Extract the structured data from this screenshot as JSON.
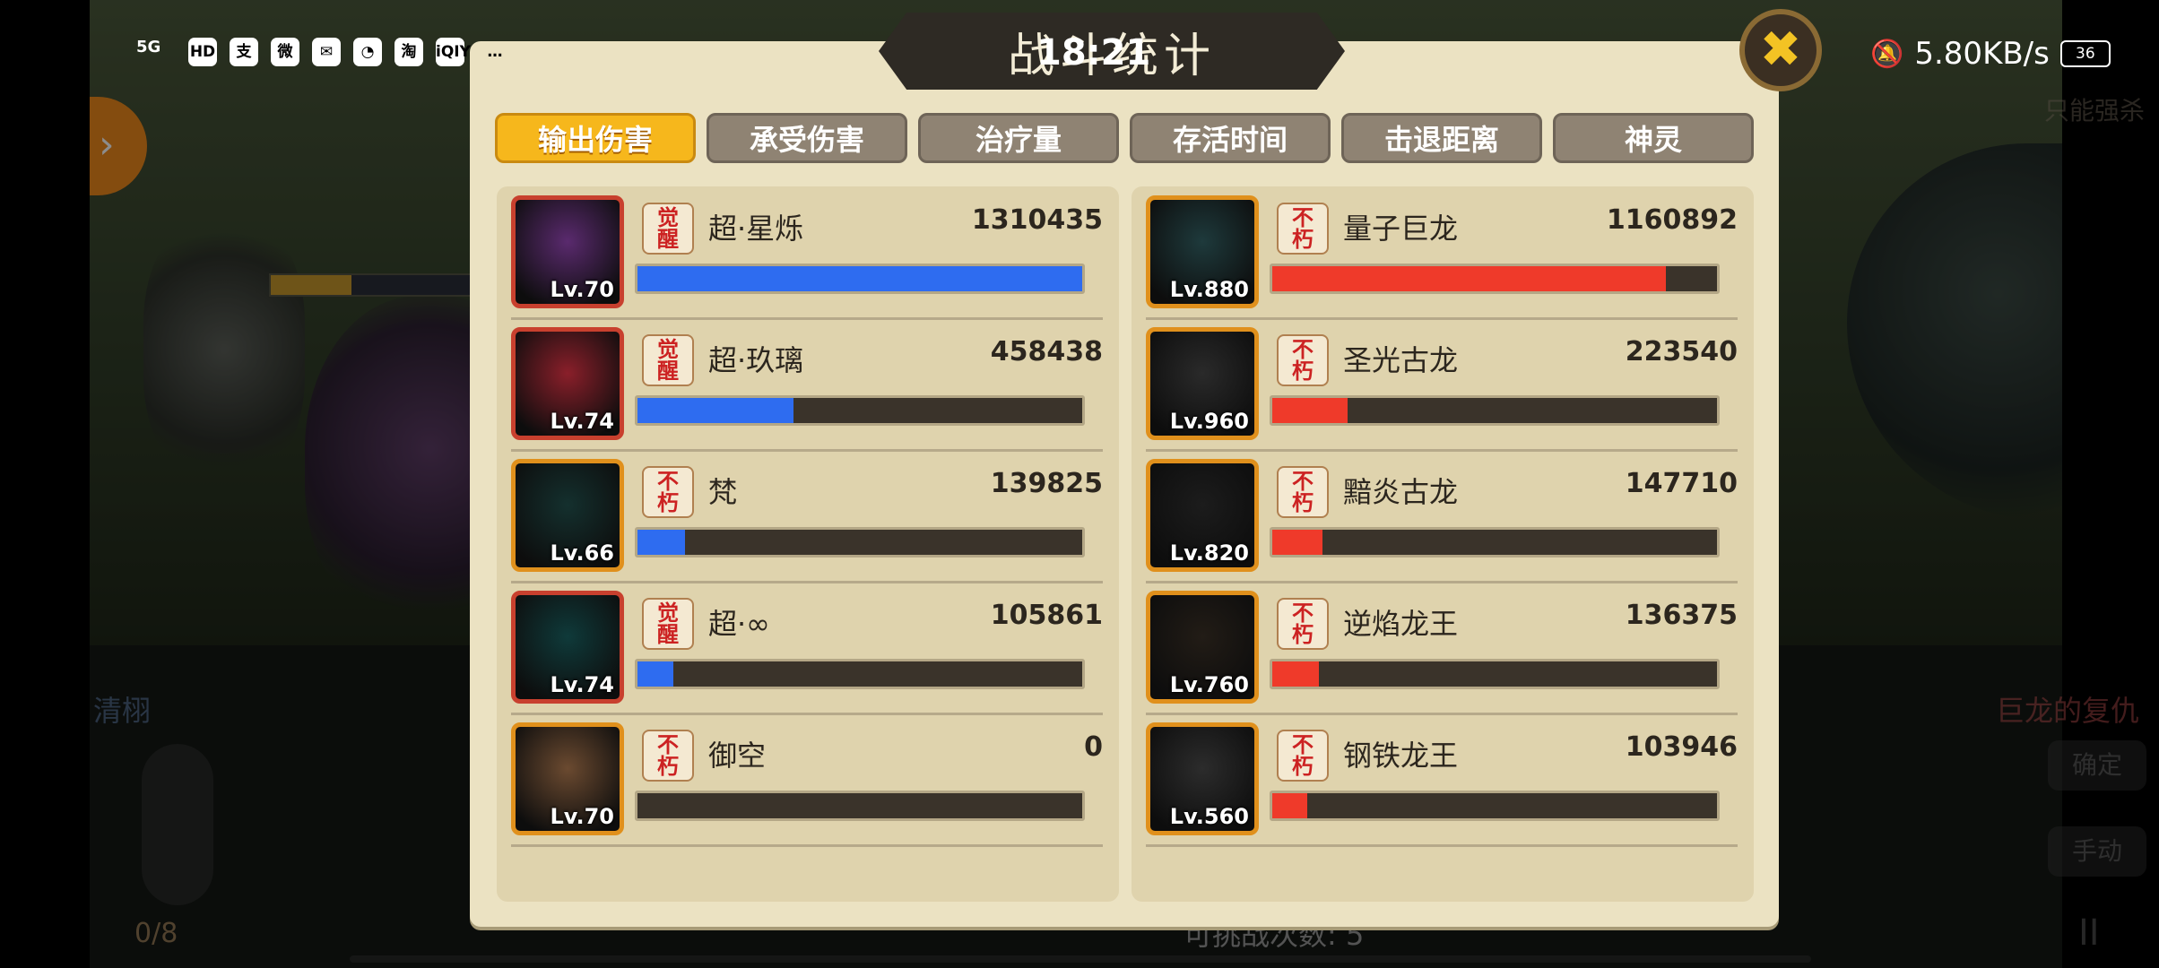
{
  "status_bar": {
    "network": "5G",
    "app_icons": [
      "HD",
      "支",
      "微",
      "✉",
      "◔",
      "淘",
      "iQIY",
      "…"
    ],
    "time": "18:21",
    "speed": "5.80KB/s",
    "battery": "36"
  },
  "background": {
    "left_label": "清栩",
    "right_top_label": "只能强杀",
    "right_label": "巨龙的复仇",
    "buttons": [
      "确定",
      "手动"
    ],
    "gauge_count": "0/8",
    "challenge_text": "可挑战次数: 5",
    "pause": "II"
  },
  "panel": {
    "title": "战斗统计",
    "close_icon": "✖",
    "tabs": [
      {
        "label": "输出伤害",
        "active": true
      },
      {
        "label": "承受伤害",
        "active": false
      },
      {
        "label": "治疗量",
        "active": false
      },
      {
        "label": "存活时间",
        "active": false
      },
      {
        "label": "击退距离",
        "active": false
      },
      {
        "label": "神灵",
        "active": false
      }
    ]
  },
  "colors": {
    "ally_bar": "#2e6cf0",
    "enemy_bar": "#ef3a2a"
  },
  "allies": [
    {
      "name": "超·星烁",
      "value": "1310435",
      "level": "Lv.70",
      "tag": "觉\n醒",
      "ratio": 1.0,
      "portrait": "#5a2a6e"
    },
    {
      "name": "超·玖璃",
      "value": "458438",
      "level": "Lv.74",
      "tag": "觉\n醒",
      "ratio": 0.35,
      "portrait": "#8a1f2a"
    },
    {
      "name": "梵",
      "value": "139825",
      "level": "Lv.66",
      "tag": "不\n朽",
      "ratio": 0.107,
      "portrait": "#14302e"
    },
    {
      "name": "超·∞",
      "value": "105861",
      "level": "Lv.74",
      "tag": "觉\n醒",
      "ratio": 0.081,
      "portrait": "#0f3a3a"
    },
    {
      "name": "御空",
      "value": "0",
      "level": "Lv.70",
      "tag": "不\n朽",
      "ratio": 0,
      "portrait": "#6b4a30"
    }
  ],
  "enemies": [
    {
      "name": "量子巨龙",
      "value": "1160892",
      "level": "Lv.880",
      "tag": "不\n朽",
      "ratio": 0.885,
      "portrait": "#1e3a3c"
    },
    {
      "name": "圣光古龙",
      "value": "223540",
      "level": "Lv.960",
      "tag": "不\n朽",
      "ratio": 0.17,
      "portrait": "#2a2a2a"
    },
    {
      "name": "黯炎古龙",
      "value": "147710",
      "level": "Lv.820",
      "tag": "不\n朽",
      "ratio": 0.113,
      "portrait": "#1c1c1c"
    },
    {
      "name": "逆焰龙王",
      "value": "136375",
      "level": "Lv.760",
      "tag": "不\n朽",
      "ratio": 0.104,
      "portrait": "#221c16"
    },
    {
      "name": "钢铁龙王",
      "value": "103946",
      "level": "Lv.560",
      "tag": "不\n朽",
      "ratio": 0.079,
      "portrait": "#2c2c2c"
    }
  ]
}
